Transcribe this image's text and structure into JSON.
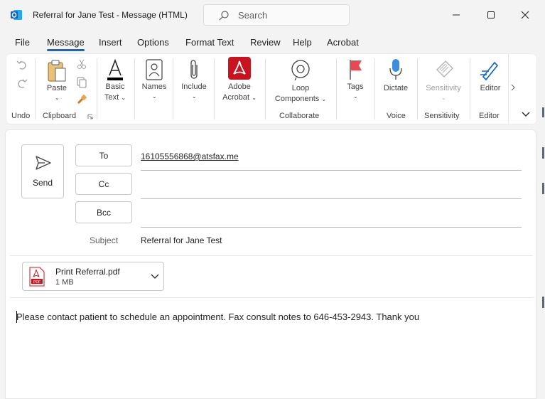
{
  "window": {
    "title": "Referral for Jane Test  -  Message (HTML)",
    "search_placeholder": "Search"
  },
  "tabs": [
    {
      "label": "File"
    },
    {
      "label": "Message",
      "active": true
    },
    {
      "label": "Insert"
    },
    {
      "label": "Options"
    },
    {
      "label": "Format Text"
    },
    {
      "label": "Review"
    },
    {
      "label": "Help"
    },
    {
      "label": "Acrobat"
    }
  ],
  "ribbon": {
    "paste": "Paste",
    "basic_text_1": "Basic",
    "basic_text_2": "Text",
    "names": "Names",
    "include": "Include",
    "adobe_1": "Adobe",
    "adobe_2": "Acrobat",
    "loop_1": "Loop",
    "loop_2": "Components",
    "tags": "Tags",
    "dictate": "Dictate",
    "sensitivity": "Sensitivity",
    "editor": "Editor",
    "groups": {
      "undo": "Undo",
      "clipboard": "Clipboard",
      "collaborate": "Collaborate",
      "voice": "Voice",
      "sensitivity": "Sensitivity",
      "editor": "Editor"
    }
  },
  "compose": {
    "send_label": "Send",
    "to_label": "To",
    "cc_label": "Cc",
    "bcc_label": "Bcc",
    "to_value": "16105556868@atsfax.me",
    "cc_value": "",
    "bcc_value": "",
    "subject_label": "Subject",
    "subject_value": "Referral for Jane Test",
    "attachment": {
      "name": "Print Referral.pdf",
      "size": "1 MB",
      "badge": "PDF"
    },
    "body": "Please contact patient to schedule an appointment. Fax consult notes to 646-453-2943. Thank you"
  },
  "colors": {
    "accent": "#0f6cbd",
    "outlook_blue": "#0a64c8",
    "acrobat_red": "#c8141e",
    "tag_red": "#e8484f"
  }
}
